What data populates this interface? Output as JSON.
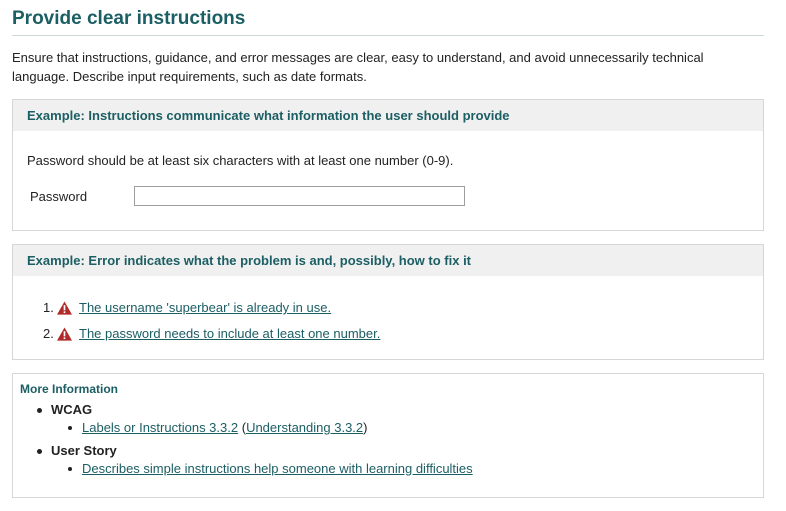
{
  "title": "Provide clear instructions",
  "intro": "Ensure that instructions, guidance, and error messages are clear, easy to understand, and avoid unnecessarily technical language. Describe input requirements, such as date formats.",
  "example1": {
    "heading": "Example: Instructions communicate what information the user should provide",
    "instruction": "Password should be at least six characters with at least one number (0-9).",
    "field_label": "Password",
    "field_value": ""
  },
  "example2": {
    "heading": "Example: Error indicates what the problem is and, possibly, how to fix it",
    "errors": [
      {
        "number": "1.",
        "text": "The username 'superbear' is already in use."
      },
      {
        "number": "2.",
        "text": "The password needs to include at least one number."
      }
    ]
  },
  "more": {
    "heading": "More Information",
    "wcag_label": "WCAG",
    "wcag_link": "Labels or Instructions 3.3.2",
    "wcag_paren_open": "(",
    "wcag_understanding": "Understanding 3.3.2",
    "wcag_paren_close": ")",
    "story_label": "User Story",
    "story_link": "Describes simple instructions help someone with learning difficulties"
  },
  "colors": {
    "accent": "#1b5e63",
    "warning": "#b02a2a",
    "panel_header": "#f0f0f0"
  },
  "icons": {
    "error": "warning-triangle-icon"
  }
}
